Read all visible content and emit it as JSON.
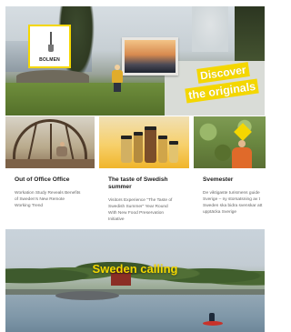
{
  "hero": {
    "bolmen_label": "BOLMEN",
    "tagline_line1": "Discover",
    "tagline_line2": "the originals"
  },
  "cards": [
    {
      "title": "Out of Office Office",
      "text": [
        "Workation Study Reveals Benefits",
        "of Sweden's New Remote",
        "Working Trend"
      ]
    },
    {
      "title": [
        "The taste of Swedish",
        "summer"
      ],
      "text": [
        "Visitors Experience \"The Taste of",
        "Swedish Summer\" Year Round",
        "With New Food Preservation",
        "Initiative"
      ]
    },
    {
      "title": "Svemester",
      "text": [
        "De viktigaste turismens guide",
        "Sverige – ny storsatsning av t",
        "Sweden ska bidra svenskar att",
        "upptäcka Sverige"
      ]
    }
  ],
  "bottom": {
    "title": "Sweden calling"
  },
  "colors": {
    "brand_yellow": "#f4d700"
  },
  "icons": [
    "shovel-icon"
  ]
}
